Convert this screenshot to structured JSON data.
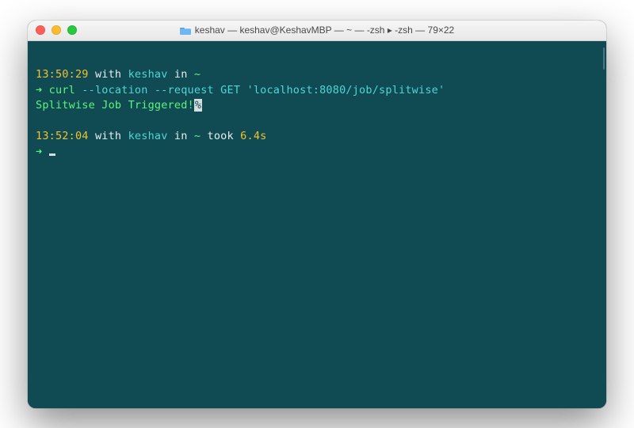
{
  "window": {
    "title": "keshav — keshav@KeshavMBP — ~ — -zsh ▸ -zsh — 79×22"
  },
  "prompt1": {
    "time": "13:50:29",
    "with": " with ",
    "user": "keshav",
    "in": " in ",
    "path": "~"
  },
  "command1": {
    "arrow": "➜ ",
    "cmd": "curl ",
    "args": "--location --request GET 'localhost:8080/job/splitwise'"
  },
  "output1": {
    "text": "Splitwise Job Triggered!",
    "percent": "%"
  },
  "prompt2": {
    "time": "13:52:04",
    "with": " with ",
    "user": "keshav",
    "in": " in ",
    "path": "~",
    "took_label": " took ",
    "took_value": "6.4s"
  },
  "command2": {
    "arrow": "➜ "
  }
}
